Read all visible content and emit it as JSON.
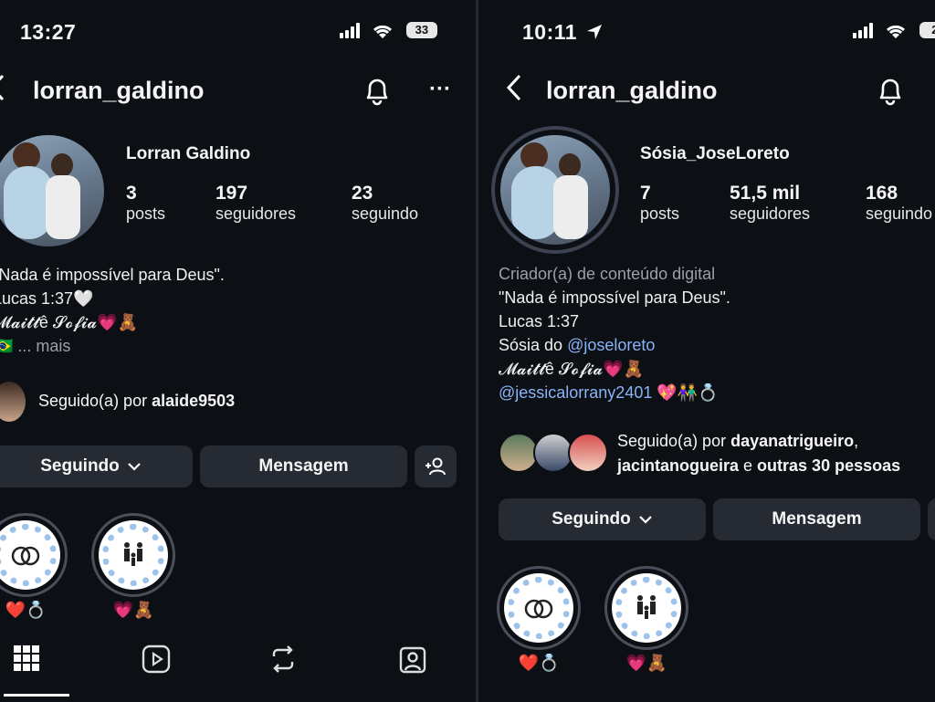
{
  "left": {
    "status": {
      "time": "13:27",
      "battery": "33"
    },
    "header": {
      "username": "lorran_galdino",
      "back_glyph": "‹",
      "more_glyph": "···"
    },
    "profile": {
      "display_name": "Lorran Galdino",
      "stats": [
        {
          "value": "3",
          "label": "posts"
        },
        {
          "value": "197",
          "label": "seguidores"
        },
        {
          "value": "23",
          "label": "seguindo"
        }
      ],
      "bio": [
        "\"Nada é impossível para Deus\".",
        "Lucas 1:37🤍",
        "𝓜𝓪𝓲𝓽𝓽ê 𝓢𝓸𝓯𝓲𝓪💗🧸",
        "🇧🇷 ... mais"
      ],
      "followed_by_prefix": "Seguido(a) por ",
      "followed_by_user": "alaide9503"
    },
    "buttons": {
      "following": "Seguindo",
      "message": "Mensagem",
      "chevron": "⌄"
    },
    "highlights": [
      {
        "label": "❤️💍"
      },
      {
        "label": "💗🧸"
      }
    ]
  },
  "right": {
    "status": {
      "time": "10:11",
      "battery": "2"
    },
    "header": {
      "username": "lorran_galdino",
      "back_glyph": "‹"
    },
    "profile": {
      "display_name": "Sósia_JoseLoreto",
      "stats": [
        {
          "value": "7",
          "label": "posts"
        },
        {
          "value": "51,5 mil",
          "label": "seguidores"
        },
        {
          "value": "168",
          "label": "seguindo"
        }
      ],
      "category": "Criador(a) de conteúdo digital",
      "bio_line1": "\"Nada é impossível para Deus\".",
      "bio_line2": "Lucas 1:37",
      "bio_line3_prefix": "Sósia do ",
      "bio_line3_link": "@joseloreto",
      "bio_line4": "𝓜𝓪𝓲𝓽𝓽ê 𝓢𝓸𝓯𝓲𝓪💗🧸",
      "bio_line5_link": "@jessicalorrany2401",
      "bio_line5_emoji": " 💖👫💍",
      "followed_prefix": "Seguido(a) por ",
      "followed_user1": "dayanatrigueiro",
      "followed_comma": ",",
      "followed_user2": "jacintanogueira",
      "followed_mid": " e ",
      "followed_others": "outras 30 pessoas"
    },
    "buttons": {
      "following": "Seguindo",
      "message": "Mensagem",
      "chevron": "⌄"
    },
    "highlights": [
      {
        "label": "❤️💍"
      },
      {
        "label": "💗🧸"
      }
    ]
  }
}
